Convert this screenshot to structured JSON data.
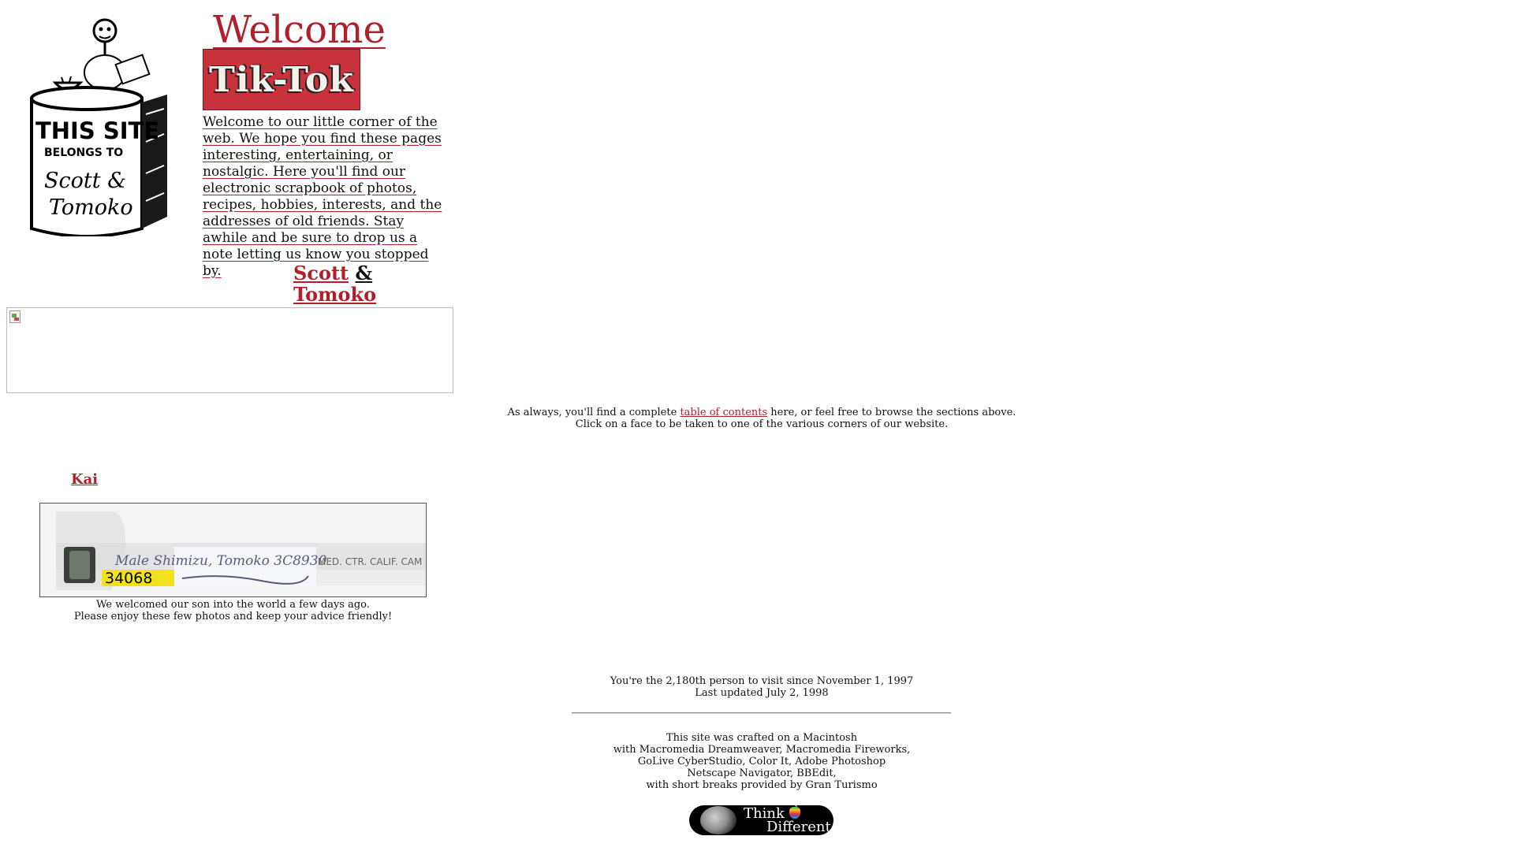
{
  "header": {
    "title": "Welcome",
    "banner_text": "Tik-Tok",
    "intro": "Welcome to our little corner of the web. We hope you find these pages interesting, entertaining, or nostalgic. Here you'll find our electronic scrapbook of photos, recipes, hobbies, interests, and the addresses of old friends. Stay awhile and be sure to drop us a note letting us know you stopped by.",
    "name1": "Scott",
    "amp": "&",
    "name2": "Tomoko",
    "logo": {
      "line1": "THIS SITE",
      "line2": "BELONGS TO",
      "line3": "Scott &",
      "line4": "Tomoko"
    }
  },
  "toc": {
    "before": "As always, you'll find a complete ",
    "link": "table of contents",
    "after": " here, or feel free to browse the sections above.",
    "line2": "Click on a face to be taken to one of the various corners of our website."
  },
  "kai": {
    "link": "Kai",
    "bracelet_number": "34068",
    "bracelet_name": "Male Shimizu, Tomoko 3C8930",
    "bracelet_hospital": "MED. CTR. CALIF. CAM",
    "caption1": "We welcomed our son into the world a few days ago.",
    "caption2": "Please enjoy these few photos and keep your advice friendly!"
  },
  "footer": {
    "visitor": "You're the 2,180th person to visit since November 1, 1997",
    "updated": "Last updated July 2, 1998",
    "credits": [
      "This site was crafted on a Macintosh",
      "with Macromedia Dreamweaver, Macromedia Fireworks,",
      "GoLive CyberStudio, Color It, Adobe Photoshop",
      "Netscape Navigator, BBEdit,",
      "with short breaks provided by Gran Turismo"
    ],
    "badge_line1": "Think",
    "badge_line2": "Different"
  },
  "colors": {
    "link": "#b01f2b",
    "banner": "#c7323c",
    "text": "#111111"
  }
}
